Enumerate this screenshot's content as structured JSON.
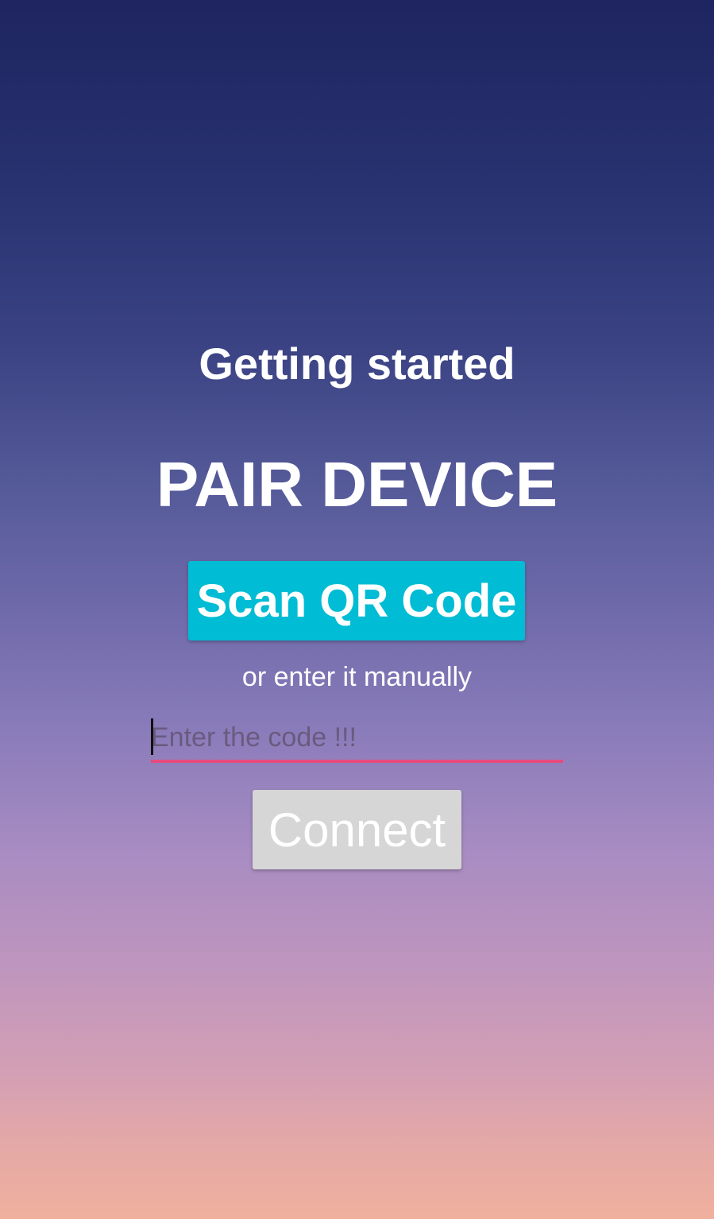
{
  "pairing": {
    "subtitle": "Getting started",
    "title": "PAIR DEVICE",
    "scan_button_label": "Scan QR Code",
    "or_text": "or enter it manually",
    "code_input": {
      "value": "",
      "placeholder": "Enter the code !!!"
    },
    "connect_button_label": "Connect"
  },
  "colors": {
    "scan_button": "#00bcd4",
    "input_underline": "#e84a7f",
    "connect_button_disabled": "#d6d6d6"
  }
}
